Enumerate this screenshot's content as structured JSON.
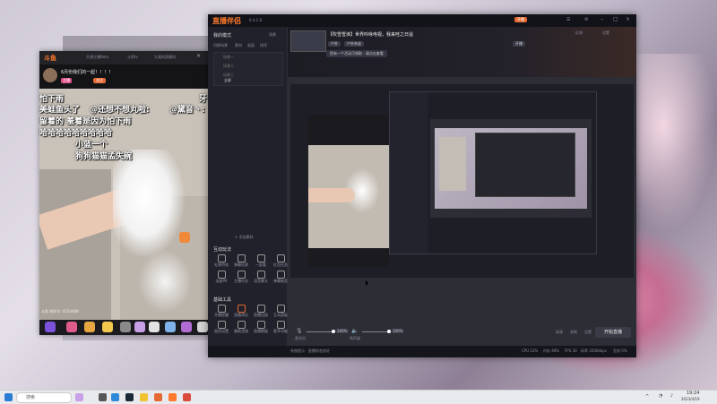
{
  "left_window": {
    "logo": "斗鱼",
    "tabs": [
      "开通主播Beta",
      "斗鱼tv",
      "九尾的直播间"
    ],
    "room_title": "6月份我们的一起！！！！",
    "room_id": "4254408",
    "level_badge": "主播",
    "follow": "关注",
    "subtitles": {
      "line1a": "怕下雨",
      "line1b": "牙",
      "line2a": "美蛙鱼头了",
      "line2b": "@还想不想丸啦:",
      "line2c": "@黛音丶:",
      "line3": "留着的 羞着是因为怕下雨",
      "line4": "哈哈哈哈哈哈哈哈哈",
      "line5": "小蓝一个",
      "line6": "狗狗猫猫孟失碗"
    },
    "room_stat": "斗鱼 房间号: 4254408"
  },
  "right_window": {
    "app_name": "直播伴侣",
    "version": "6.4.1.8",
    "title_actions": [
      "开播",
      "反馈",
      "设置"
    ],
    "stream_title": "【吹雪雪演】世界吟咏电视，我来哇之日遥",
    "tag1": "户外",
    "tag2": "户外杂谈",
    "tag3": "开播",
    "notice": "您有一个活动可领取 · 请点击查看",
    "side_header_left": "我的模式",
    "side_header_right": "场景",
    "side_sub": [
      "切换场景",
      "素材",
      "画面",
      "排序"
    ],
    "scenes": [
      "场景一",
      "场景二",
      "场景三",
      "全屏"
    ],
    "add_source": "+ 添加素材",
    "section_interact": "互动玩法",
    "tools_row1": [
      "礼物特效",
      "弹幕投票",
      "一起看",
      "红包任务"
    ],
    "tools_row2": [
      "连麦PK",
      "主播任务",
      "语音聊天",
      "弹幕抽奖"
    ],
    "section_basic": "基础工具",
    "tools_row3": [
      "开播提醒",
      "直播预告",
      "直播回放",
      "互动面板"
    ],
    "tools_row4": [
      "画质设置",
      "美颜滤镜",
      "直播数据",
      "更多功能"
    ],
    "more_tools": "··· 更多功能",
    "mic_label": "麦克风",
    "mic_value": "100%",
    "speaker_label": "扬声器",
    "speaker_value": "100%",
    "bottom_icons": [
      "高清",
      "录制",
      "设置"
    ],
    "start_button": "开始直播",
    "status_left": "系统提示 · 直播状态良好",
    "status_right": [
      "CPU 12%",
      "内存 48%",
      "FPS 30",
      "码率 3500kbps",
      "丢帧 0%"
    ]
  },
  "taskbar": {
    "search_placeholder": "搜索",
    "time": "19:24",
    "date": "2023/4/19"
  },
  "colors": {
    "accent": "#e46a34",
    "douyu": "#ff7a2c"
  }
}
